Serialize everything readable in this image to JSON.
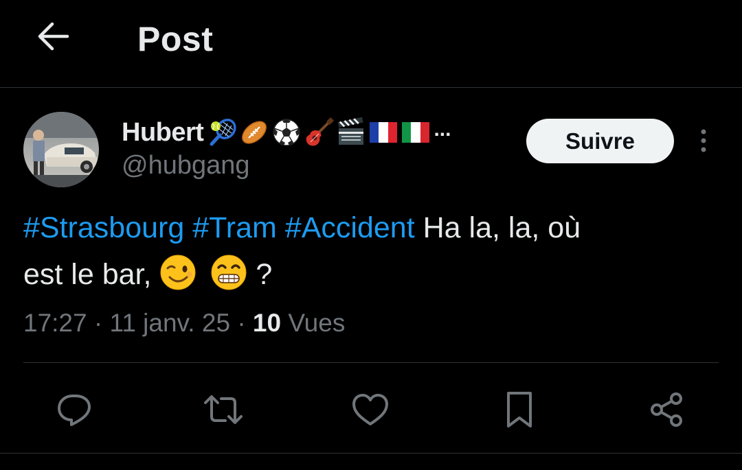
{
  "header": {
    "title": "Post",
    "back_icon": "arrow-left-icon"
  },
  "author": {
    "name": "Hubert",
    "name_emojis": [
      "tennis-icon",
      "rugby-football-icon",
      "soccer-ball-icon",
      "guitar-icon",
      "clapper-board-icon",
      "flag-france-icon",
      "flag-italy-icon"
    ],
    "name_overflow": "...",
    "handle": "@hubgang",
    "follow_label": "Suivre"
  },
  "post": {
    "hashtags": [
      "#Strasbourg",
      "#Tram",
      "#Accident"
    ],
    "text_part1": "Ha la, la, où",
    "text_part2": "est le bar,",
    "text_end": "?",
    "emojis": [
      "winking-face-icon",
      "grinning-face-icon"
    ],
    "time": "17:27",
    "date": "11 janv. 25",
    "separator": "·",
    "views_count": "10",
    "views_label": "Vues"
  },
  "actions": [
    "reply-icon",
    "repost-icon",
    "like-icon",
    "bookmark-icon",
    "share-icon"
  ],
  "colors": {
    "background": "#000000",
    "text": "#e7e9ea",
    "muted": "#71767b",
    "link": "#1d9bf0",
    "divider": "#2f3336",
    "button_bg": "#eff3f4"
  }
}
